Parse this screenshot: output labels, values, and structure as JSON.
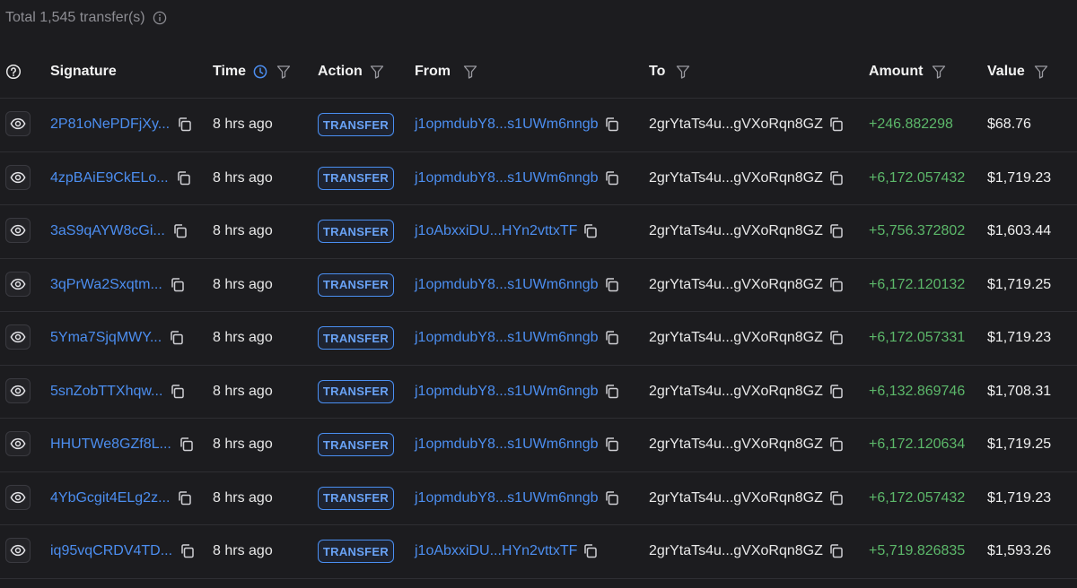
{
  "summary": {
    "total_text": "Total 1,545 transfer(s)"
  },
  "columns": {
    "signature": "Signature",
    "time": "Time",
    "action": "Action",
    "from": "From",
    "to": "To",
    "amount": "Amount",
    "value": "Value"
  },
  "colors": {
    "background": "#1c1c1f",
    "link": "#4c8ef0",
    "amount_positive": "#5cb86a",
    "badge_border": "#4a8ff2"
  },
  "rows": [
    {
      "signature": "2P81oNePDFjXy...",
      "time": "8 hrs ago",
      "action": "TRANSFER",
      "from": "j1opmdubY8...s1UWm6nngb",
      "to": "2grYtaTs4u...gVXoRqn8GZ",
      "amount": "+246.882298",
      "value": "$68.76"
    },
    {
      "signature": "4zpBAiE9CkELo...",
      "time": "8 hrs ago",
      "action": "TRANSFER",
      "from": "j1opmdubY8...s1UWm6nngb",
      "to": "2grYtaTs4u...gVXoRqn8GZ",
      "amount": "+6,172.057432",
      "value": "$1,719.23"
    },
    {
      "signature": "3aS9qAYW8cGi...",
      "time": "8 hrs ago",
      "action": "TRANSFER",
      "from": "j1oAbxxiDU...HYn2vttxTF",
      "to": "2grYtaTs4u...gVXoRqn8GZ",
      "amount": "+5,756.372802",
      "value": "$1,603.44"
    },
    {
      "signature": "3qPrWa2Sxqtm...",
      "time": "8 hrs ago",
      "action": "TRANSFER",
      "from": "j1opmdubY8...s1UWm6nngb",
      "to": "2grYtaTs4u...gVXoRqn8GZ",
      "amount": "+6,172.120132",
      "value": "$1,719.25"
    },
    {
      "signature": "5Yma7SjqMWY...",
      "time": "8 hrs ago",
      "action": "TRANSFER",
      "from": "j1opmdubY8...s1UWm6nngb",
      "to": "2grYtaTs4u...gVXoRqn8GZ",
      "amount": "+6,172.057331",
      "value": "$1,719.23"
    },
    {
      "signature": "5snZobTTXhqw...",
      "time": "8 hrs ago",
      "action": "TRANSFER",
      "from": "j1opmdubY8...s1UWm6nngb",
      "to": "2grYtaTs4u...gVXoRqn8GZ",
      "amount": "+6,132.869746",
      "value": "$1,708.31"
    },
    {
      "signature": "HHUTWe8GZf8L...",
      "time": "8 hrs ago",
      "action": "TRANSFER",
      "from": "j1opmdubY8...s1UWm6nngb",
      "to": "2grYtaTs4u...gVXoRqn8GZ",
      "amount": "+6,172.120634",
      "value": "$1,719.25"
    },
    {
      "signature": "4YbGcgit4ELg2z...",
      "time": "8 hrs ago",
      "action": "TRANSFER",
      "from": "j1opmdubY8...s1UWm6nngb",
      "to": "2grYtaTs4u...gVXoRqn8GZ",
      "amount": "+6,172.057432",
      "value": "$1,719.23"
    },
    {
      "signature": "iq95vqCRDV4TD...",
      "time": "8 hrs ago",
      "action": "TRANSFER",
      "from": "j1oAbxxiDU...HYn2vttxTF",
      "to": "2grYtaTs4u...gVXoRqn8GZ",
      "amount": "+5,719.826835",
      "value": "$1,593.26"
    }
  ]
}
